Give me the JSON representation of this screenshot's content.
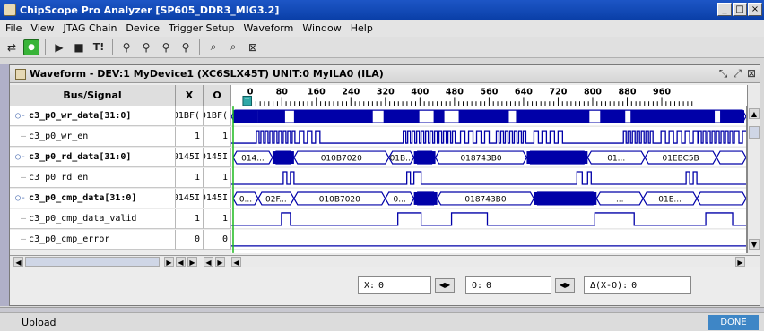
{
  "window": {
    "title": "ChipScope Pro Analyzer [SP605_DDR3_MIG3.2]",
    "buttons": [
      "_",
      "□",
      "×"
    ]
  },
  "menu": [
    "File",
    "View",
    "JTAG Chain",
    "Device",
    "Trigger Setup",
    "Waveform",
    "Window",
    "Help"
  ],
  "toolbar": {
    "icons": [
      "jtag-chain-icon",
      "run-icon",
      "play-icon",
      "stop-icon",
      "trigger-immediate-icon",
      "separator",
      "zoom-in-icon",
      "zoom-out-icon",
      "zoom-in-alt-icon",
      "zoom-out-alt-icon",
      "separator",
      "find-icon",
      "find-next-icon",
      "zoom-fit-icon"
    ],
    "trigger_label": "T!"
  },
  "waveform_window": {
    "title": "Waveform - DEV:1 MyDevice1 (XC6SLX45T) UNIT:0 MyILA0 (ILA)",
    "columns": {
      "bus_signal": "Bus/Signal",
      "x": "X",
      "o": "O"
    },
    "ruler_labels": [
      "0",
      "80",
      "160",
      "240",
      "320",
      "400",
      "480",
      "560",
      "640",
      "720",
      "800",
      "880",
      "960"
    ],
    "signals": [
      {
        "name": "c3_p0_wr_data[31:0]",
        "x": "01BF(",
        "o": "01BF(",
        "bus": true,
        "labels": []
      },
      {
        "name": "c3_p0_wr_en",
        "x": "1",
        "o": "1",
        "bus": false
      },
      {
        "name": "c3_p0_rd_data[31:0]",
        "x": "0145I",
        "o": "0145I",
        "bus": true,
        "labels": [
          "014...",
          "010B7020",
          "01B...",
          "018743B0",
          "01...",
          "01EBC5B"
        ]
      },
      {
        "name": "c3_p0_rd_en",
        "x": "1",
        "o": "1",
        "bus": false
      },
      {
        "name": "c3_p0_cmp_data[31:0]",
        "x": "0145I",
        "o": "0145I",
        "bus": true,
        "labels": [
          "0...",
          "02F...",
          "010B7020",
          "0...",
          "018743B0",
          "...",
          "01E..."
        ]
      },
      {
        "name": "c3_p0_cmp_data_valid",
        "x": "1",
        "o": "1",
        "bus": false
      },
      {
        "name": "c3_p0_cmp_error",
        "x": "0",
        "o": "0",
        "bus": false
      }
    ],
    "trigger_marker": "T",
    "cursor": {
      "x_label": "X:",
      "x_value": "0",
      "o_label": "O:",
      "o_value": "0",
      "delta_label": "Δ(X-O):",
      "delta_value": "0"
    }
  },
  "status": {
    "text": "Upload",
    "state": "DONE"
  }
}
